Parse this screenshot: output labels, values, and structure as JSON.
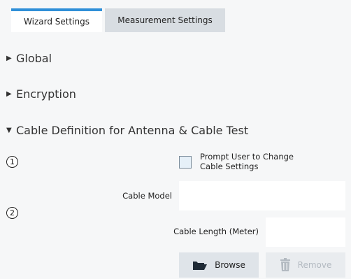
{
  "tabs": [
    {
      "label": "Wizard Settings",
      "active": true
    },
    {
      "label": "Measurement Settings",
      "active": false
    }
  ],
  "sections": {
    "global": "Global",
    "encryption": "Encryption",
    "cable": "Cable Definition for Antenna & Cable Test"
  },
  "markers": {
    "one": "1",
    "two": "2"
  },
  "prompt_checkbox": {
    "label_line1": "Prompt User to Change",
    "label_line2": "Cable Settings",
    "checked": false
  },
  "cable_model": {
    "label": "Cable Model",
    "value": ""
  },
  "cable_length": {
    "label": "Cable Length (Meter)",
    "value": ""
  },
  "buttons": {
    "browse": "Browse",
    "remove": "Remove"
  },
  "colors": {
    "accent": "#2f8fd8",
    "background": "#f6f7f8",
    "disabled_text": "#b3bac1"
  }
}
